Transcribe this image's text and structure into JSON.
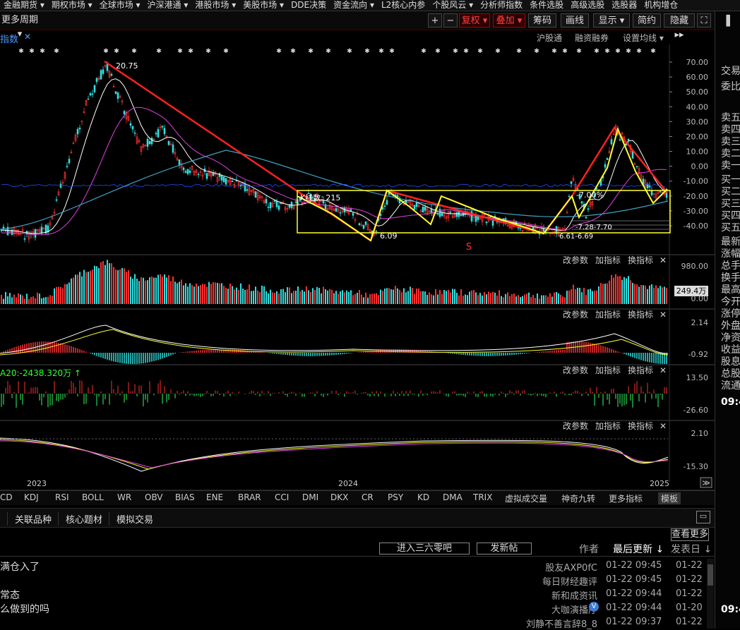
{
  "top_menu": [
    "金融期货 ▾",
    "期权市场 ▾",
    "全球市场 ▾",
    "沪深港通 ▾",
    "港股市场 ▾",
    "美股市场 ▾",
    "DDE决策",
    "资金流向 ▾",
    "L2核心内参",
    "个股风云 ▾",
    "分析师指数",
    "条件选股",
    "高级选股",
    "选股器",
    "机构增仓"
  ],
  "toolbar": {
    "period": "更多周期 ▾",
    "plus": "+",
    "minus": "−",
    "fuquan": "复权 ▾",
    "diejia": "叠加 ▾",
    "chouma": "筹码",
    "huaxian": "画线",
    "xianshi": "显示 ▾",
    "jianyue": "简约",
    "yincang": "隐藏 ▸▸",
    "close": "✕",
    "fullscreen": "⛶"
  },
  "row2": {
    "tab": "指数",
    "tab_close": "✕",
    "hugutong": "沪股通",
    "rongzi": "融资融券",
    "junxian": "设置均线 ▾"
  },
  "right_strip": {
    "labels": [
      "交易",
      "委比",
      "卖五",
      "卖四",
      "卖三",
      "卖二",
      "卖一",
      "买一",
      "买二",
      "买三",
      "买四",
      "买五",
      "最新",
      "涨幅",
      "总手",
      "换手",
      "最高",
      "今开",
      "涨停",
      "外盘",
      "净资",
      "收益",
      "股息",
      "总股",
      "流通"
    ],
    "time1": "09:4",
    "time2": "09:4"
  },
  "chart": {
    "price_axis": [
      "70.00",
      "60.00",
      "50.00",
      "40.00",
      "30.00",
      "20.00",
      "10.00",
      "0.00",
      "-10.00",
      "-20.00",
      "-30.00",
      "-40.00"
    ],
    "high_label": "20.75",
    "low_label": "6.09",
    "box_label": "K线数: 215",
    "pct_label": "-7.00%",
    "small_labels": [
      "6.61-6.69",
      "-7.28-7.70"
    ],
    "s_mark": "S",
    "panel_btns": [
      "改参数",
      "加指标",
      "换指标",
      "✕"
    ],
    "vol_axis": [
      "980.00",
      "0.00"
    ],
    "vol_tag": "249.4万",
    "macd_axis": [
      "2.14",
      "-0.92"
    ],
    "dde_axis": [
      "13.50",
      "-26.60"
    ],
    "dde_label": "A20:-2438.320万 ↑",
    "kdj_axis": [
      "2.10",
      "-15.30"
    ],
    "dates": [
      "2023",
      "2024",
      "2025"
    ],
    "expand": "≫"
  },
  "ind_tabs": [
    "CD",
    "KDJ",
    "RSI",
    "BOLL",
    "WR",
    "OBV",
    "BIAS",
    "ENE",
    "BRAR",
    "CCI",
    "DMI",
    "DKX",
    "CR",
    "PSY",
    "KD",
    "DMA",
    "TRIX",
    "虚拟成交量",
    "神奇九转",
    "更多指标",
    "模板"
  ],
  "sub_tabs": [
    "关联品种",
    "核心题材",
    "模拟交易"
  ],
  "community": {
    "more": "查看更多",
    "enter": "进入三六零吧",
    "post": "发新帖",
    "col_author": "作者",
    "col_update": "最后更新 ↓",
    "col_post": "发表日 ↓",
    "posts": [
      {
        "title": "满仓入了",
        "author": "股友AXP0fC",
        "update": "01-22 09:45",
        "date": "01-22"
      },
      {
        "title": "",
        "author": "每日财经趣评",
        "update": "01-22 09:45",
        "date": "01-22"
      },
      {
        "title": "常态",
        "author": "新和成资讯",
        "update": "01-22 09:44",
        "date": "01-22"
      },
      {
        "title": "么做到的吗",
        "author": "大咖演播厅",
        "update": "01-22 09:44",
        "date": "01-20"
      },
      {
        "title": "",
        "author": "刘静不善言辞8_8",
        "update": "01-22 09:37",
        "date": "01-22"
      }
    ]
  },
  "colors": {
    "up": "#ff3030",
    "down": "#30e0e0",
    "yellow": "#ffff30",
    "magenta": "#e040e0",
    "ma_cyan": "#40a0c0",
    "blue": "#2050ff"
  }
}
